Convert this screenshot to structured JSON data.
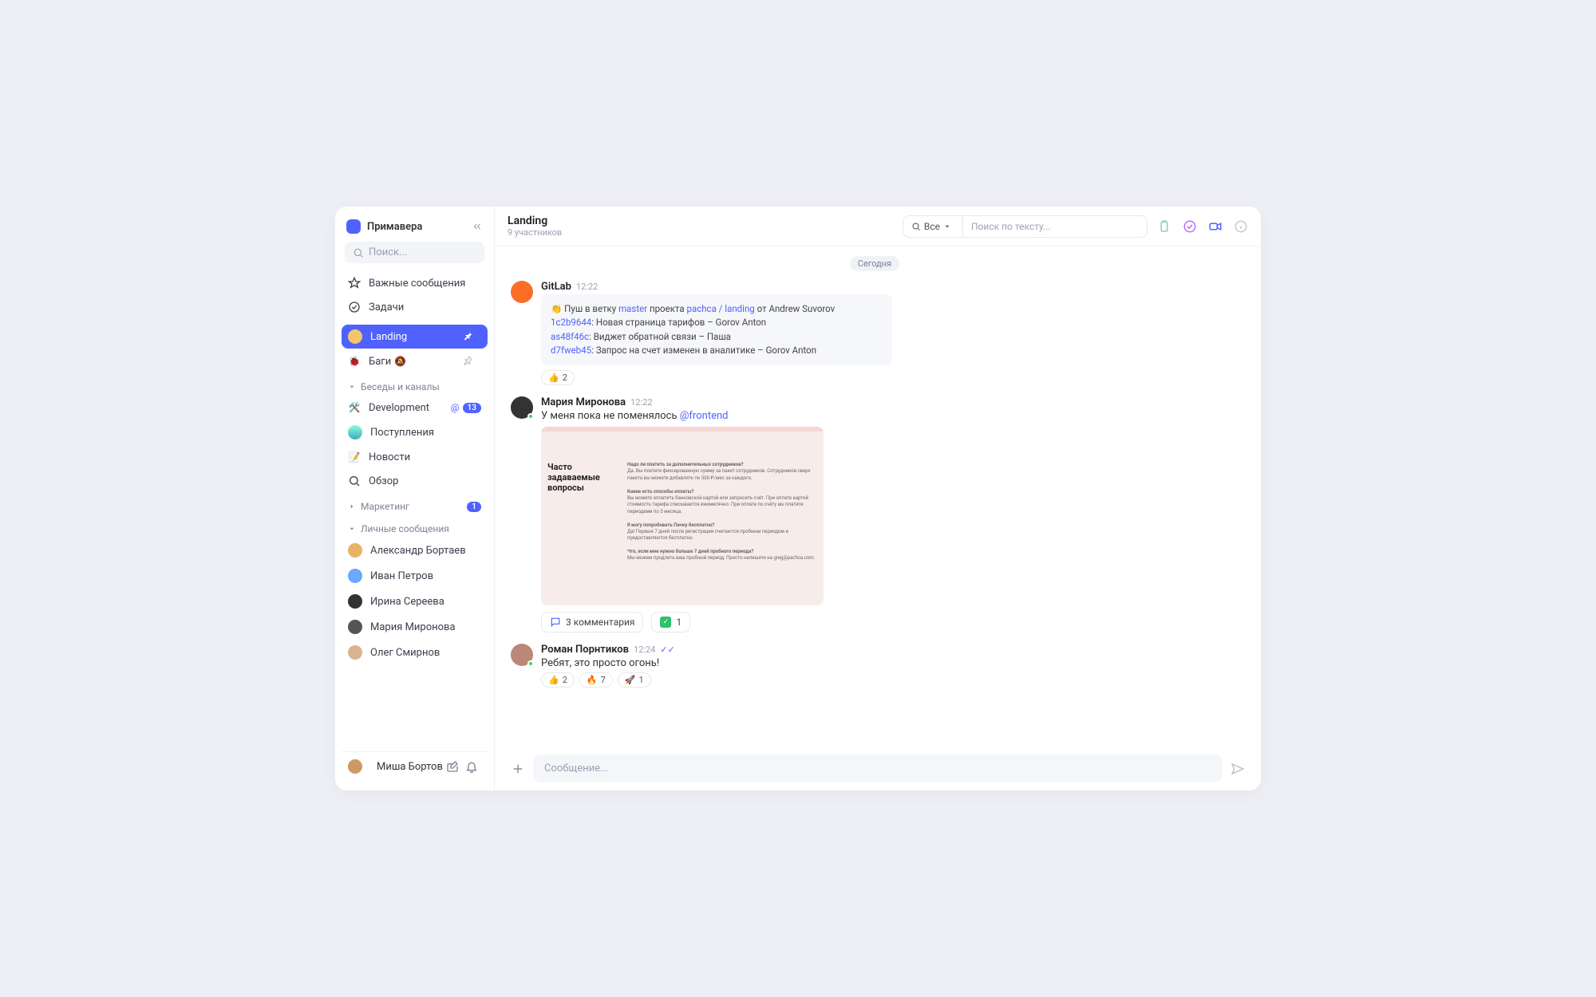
{
  "workspace": "Примавера",
  "sidebar": {
    "search_placeholder": "Поиск...",
    "important": "Важные сообщения",
    "tasks": "Задачи",
    "landing": "Landing",
    "bugs": "Баги",
    "section_channels": "Беседы и каналы",
    "development": "Development",
    "dev_badge": "13",
    "inbox": "Поступления",
    "news": "Новости",
    "overview": "Обзор",
    "marketing": "Маркетинг",
    "marketing_badge": "1",
    "section_dm": "Личные сообщения",
    "dm": [
      "Александр Бортаев",
      "Иван Петров",
      "Ирина Сереева",
      "Мария Миронова",
      "Олег Смирнов"
    ],
    "me": "Миша Бортов"
  },
  "header": {
    "title": "Landing",
    "subtitle": "9 участников",
    "filter": "Все",
    "search_placeholder": "Поиск по тексту..."
  },
  "day": "Сегодня",
  "messages": {
    "gitlab": {
      "name": "GitLab",
      "time": "12:22",
      "line1_pre": "👏 Пуш в ветку ",
      "line1_branch": "master",
      "line1_mid": " проекта ",
      "line1_proj": "pachca / landing",
      "line1_post": " от Andrew Suvorov",
      "c1_hash": "1c2b9644",
      "c1_txt": ": Новая страница тарифов – Gorov Anton",
      "c2_hash": "as48f46c",
      "c2_txt": ": Виджет обратной связи – Паша",
      "c3_hash": "d7fweb45",
      "c3_txt": ": Запрос на счет изменен в аналитике – Gorov Anton",
      "react_count": "2"
    },
    "maria": {
      "name": "Мария Миронова",
      "time": "12:22",
      "text": "У меня пока не поменялось ",
      "mention": "@frontend",
      "faq_title": "Часто задаваемые вопросы",
      "comments": "3 комментария",
      "react_count": "1"
    },
    "roman": {
      "name": "Роман Порнтиков",
      "time": "12:24",
      "text": "Ребят, это просто огонь!",
      "r1": "2",
      "r2": "7",
      "r3": "1"
    }
  },
  "composer_placeholder": "Сообщение..."
}
